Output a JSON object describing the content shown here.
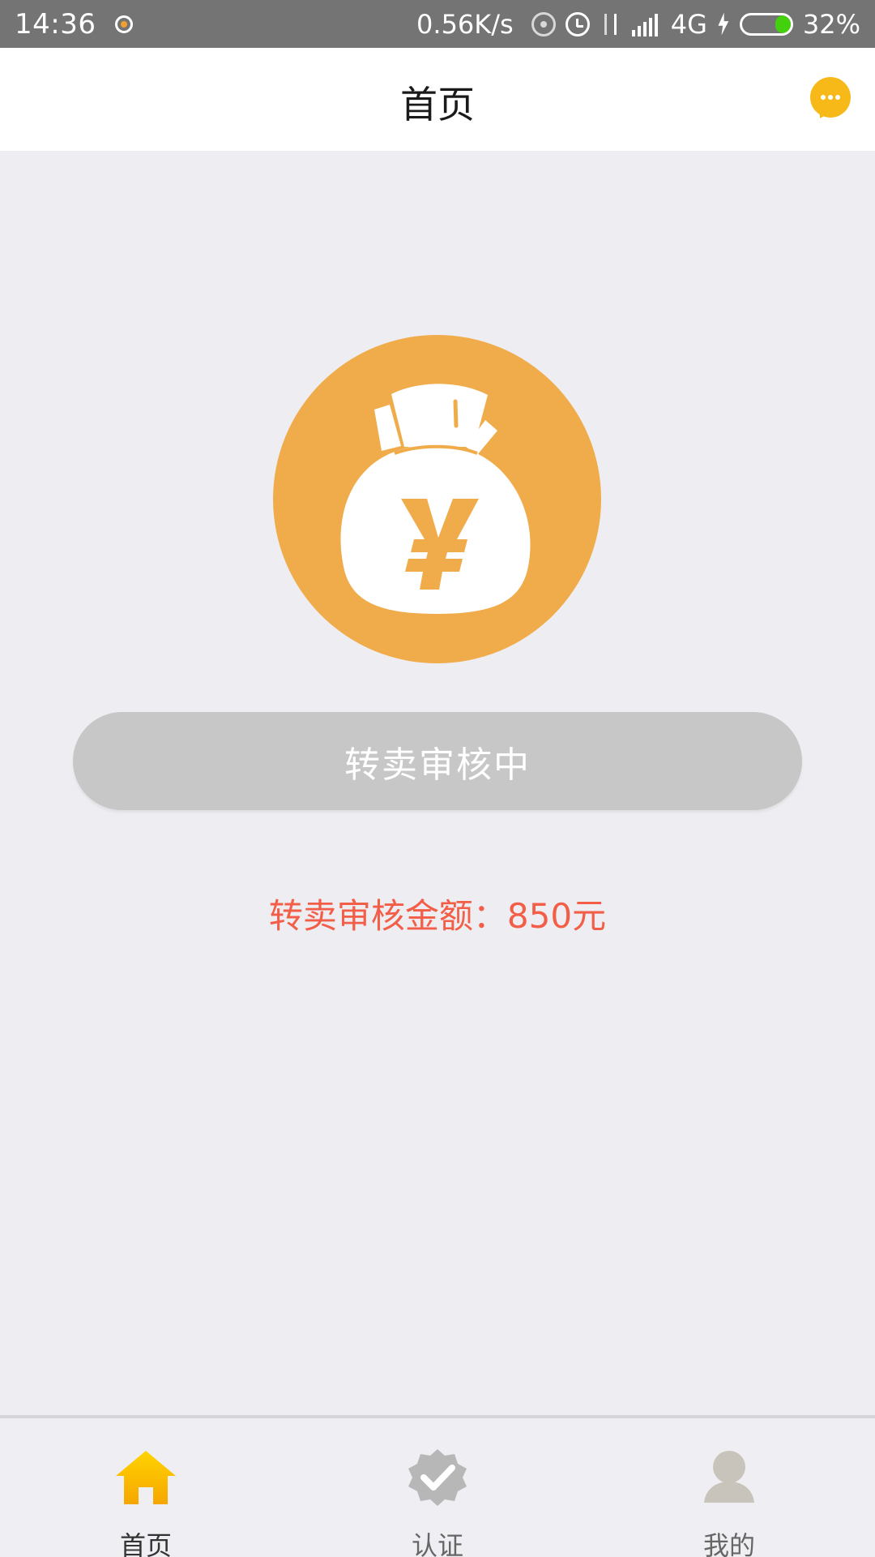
{
  "status_bar": {
    "time": "14:36",
    "network_speed": "0.56K/s",
    "network_type": "4G",
    "battery_percent": "32%",
    "battery_level": 0.32,
    "icons": [
      "app-notification-icon",
      "hotspot-icon",
      "alarm-icon",
      "data-transfer-icon",
      "signal-icon",
      "charging-icon",
      "battery-icon"
    ]
  },
  "header": {
    "title": "首页",
    "message_icon": "chat-bubble-icon"
  },
  "main": {
    "hero_icon": "money-bag-yen-icon",
    "status_button_label": "转卖审核中",
    "review_amount_text": "转卖审核金额：850元"
  },
  "bottom_nav": {
    "items": [
      {
        "label": "首页",
        "icon": "home-icon",
        "active": true
      },
      {
        "label": "认证",
        "icon": "verified-badge-icon",
        "active": false
      },
      {
        "label": "我的",
        "icon": "user-profile-icon",
        "active": false
      }
    ]
  },
  "colors": {
    "status_bar": "#747474",
    "accent_orange": "#F0AC4B",
    "accent_yellow": "#F7B918",
    "button_disabled": "#C7C7C7",
    "amount_red": "#F25E47",
    "background": "#EEEEF2"
  }
}
